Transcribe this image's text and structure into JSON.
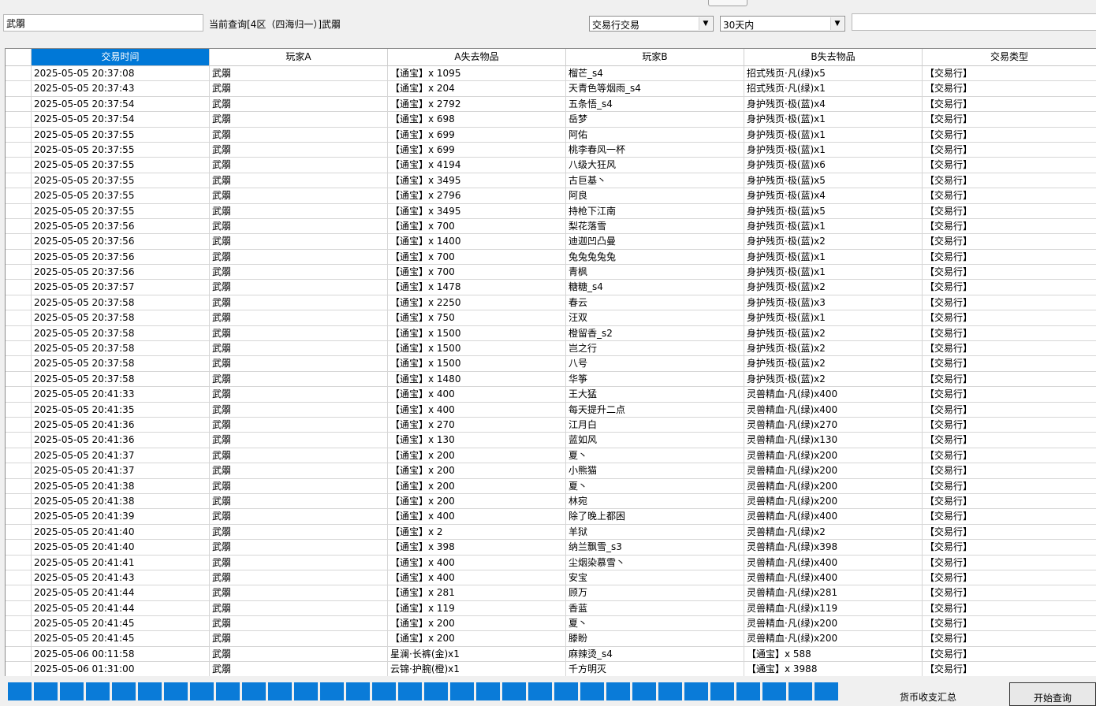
{
  "toolbar": {
    "search_value": "武朤",
    "query_label": "当前查询[4区（四海归一）]武朤",
    "trade_type_select": "交易行交易",
    "period_select": "30天内",
    "right_input_value": ""
  },
  "table": {
    "columns": [
      "交易时间",
      "玩家A",
      "A失去物品",
      "玩家B",
      "B失去物品",
      "交易类型"
    ],
    "rows": [
      [
        "2025-05-05 20:37:08",
        "武朤",
        "【通宝】x 1095",
        "榴芒_s4",
        "招式残页·凡(绿)x5",
        "【交易行】"
      ],
      [
        "2025-05-05 20:37:43",
        "武朤",
        "【通宝】x 204",
        "天青色等烟雨_s4",
        "招式残页·凡(绿)x1",
        "【交易行】"
      ],
      [
        "2025-05-05 20:37:54",
        "武朤",
        "【通宝】x 2792",
        "五条悟_s4",
        "身护残页·极(蓝)x4",
        "【交易行】"
      ],
      [
        "2025-05-05 20:37:54",
        "武朤",
        "【通宝】x 698",
        "岳梦",
        "身护残页·极(蓝)x1",
        "【交易行】"
      ],
      [
        "2025-05-05 20:37:55",
        "武朤",
        "【通宝】x 699",
        "阿佑",
        "身护残页·极(蓝)x1",
        "【交易行】"
      ],
      [
        "2025-05-05 20:37:55",
        "武朤",
        "【通宝】x 699",
        "桃李春风一杯",
        "身护残页·极(蓝)x1",
        "【交易行】"
      ],
      [
        "2025-05-05 20:37:55",
        "武朤",
        "【通宝】x 4194",
        "八级大狂风",
        "身护残页·极(蓝)x6",
        "【交易行】"
      ],
      [
        "2025-05-05 20:37:55",
        "武朤",
        "【通宝】x 3495",
        "古巨基丶",
        "身护残页·极(蓝)x5",
        "【交易行】"
      ],
      [
        "2025-05-05 20:37:55",
        "武朤",
        "【通宝】x 2796",
        "阿良",
        "身护残页·极(蓝)x4",
        "【交易行】"
      ],
      [
        "2025-05-05 20:37:55",
        "武朤",
        "【通宝】x 3495",
        "持枪下江南",
        "身护残页·极(蓝)x5",
        "【交易行】"
      ],
      [
        "2025-05-05 20:37:56",
        "武朤",
        "【通宝】x 700",
        "梨花落雪",
        "身护残页·极(蓝)x1",
        "【交易行】"
      ],
      [
        "2025-05-05 20:37:56",
        "武朤",
        "【通宝】x 1400",
        "迪迦凹凸曼",
        "身护残页·极(蓝)x2",
        "【交易行】"
      ],
      [
        "2025-05-05 20:37:56",
        "武朤",
        "【通宝】x 700",
        "兔兔兔兔兔",
        "身护残页·极(蓝)x1",
        "【交易行】"
      ],
      [
        "2025-05-05 20:37:56",
        "武朤",
        "【通宝】x 700",
        "青枫",
        "身护残页·极(蓝)x1",
        "【交易行】"
      ],
      [
        "2025-05-05 20:37:57",
        "武朤",
        "【通宝】x 1478",
        "糖糖_s4",
        "身护残页·极(蓝)x2",
        "【交易行】"
      ],
      [
        "2025-05-05 20:37:58",
        "武朤",
        "【通宝】x 2250",
        "春云",
        "身护残页·极(蓝)x3",
        "【交易行】"
      ],
      [
        "2025-05-05 20:37:58",
        "武朤",
        "【通宝】x 750",
        "汪双",
        "身护残页·极(蓝)x1",
        "【交易行】"
      ],
      [
        "2025-05-05 20:37:58",
        "武朤",
        "【通宝】x 1500",
        "橙留香_s2",
        "身护残页·极(蓝)x2",
        "【交易行】"
      ],
      [
        "2025-05-05 20:37:58",
        "武朤",
        "【通宝】x 1500",
        "岂之行",
        "身护残页·极(蓝)x2",
        "【交易行】"
      ],
      [
        "2025-05-05 20:37:58",
        "武朤",
        "【通宝】x 1500",
        "八号",
        "身护残页·极(蓝)x2",
        "【交易行】"
      ],
      [
        "2025-05-05 20:37:58",
        "武朤",
        "【通宝】x 1480",
        "华筝",
        "身护残页·极(蓝)x2",
        "【交易行】"
      ],
      [
        "2025-05-05 20:41:33",
        "武朤",
        "【通宝】x 400",
        "王大猛",
        "灵兽精血·凡(绿)x400",
        "【交易行】"
      ],
      [
        "2025-05-05 20:41:35",
        "武朤",
        "【通宝】x 400",
        "每天提升二点",
        "灵兽精血·凡(绿)x400",
        "【交易行】"
      ],
      [
        "2025-05-05 20:41:36",
        "武朤",
        "【通宝】x 270",
        "江月白",
        "灵兽精血·凡(绿)x270",
        "【交易行】"
      ],
      [
        "2025-05-05 20:41:36",
        "武朤",
        "【通宝】x 130",
        "蓝如风",
        "灵兽精血·凡(绿)x130",
        "【交易行】"
      ],
      [
        "2025-05-05 20:41:37",
        "武朤",
        "【通宝】x 200",
        "夏丶",
        "灵兽精血·凡(绿)x200",
        "【交易行】"
      ],
      [
        "2025-05-05 20:41:37",
        "武朤",
        "【通宝】x 200",
        "小熊猫",
        "灵兽精血·凡(绿)x200",
        "【交易行】"
      ],
      [
        "2025-05-05 20:41:38",
        "武朤",
        "【通宝】x 200",
        "夏丶",
        "灵兽精血·凡(绿)x200",
        "【交易行】"
      ],
      [
        "2025-05-05 20:41:38",
        "武朤",
        "【通宝】x 200",
        "林宛",
        "灵兽精血·凡(绿)x200",
        "【交易行】"
      ],
      [
        "2025-05-05 20:41:39",
        "武朤",
        "【通宝】x 400",
        "除了晚上都困",
        "灵兽精血·凡(绿)x400",
        "【交易行】"
      ],
      [
        "2025-05-05 20:41:40",
        "武朤",
        "【通宝】x 2",
        "羊狱",
        "灵兽精血·凡(绿)x2",
        "【交易行】"
      ],
      [
        "2025-05-05 20:41:40",
        "武朤",
        "【通宝】x 398",
        "纳兰飘雪_s3",
        "灵兽精血·凡(绿)x398",
        "【交易行】"
      ],
      [
        "2025-05-05 20:41:41",
        "武朤",
        "【通宝】x 400",
        "尘烟染慕雪丶",
        "灵兽精血·凡(绿)x400",
        "【交易行】"
      ],
      [
        "2025-05-05 20:41:43",
        "武朤",
        "【通宝】x 400",
        "安宝",
        "灵兽精血·凡(绿)x400",
        "【交易行】"
      ],
      [
        "2025-05-05 20:41:44",
        "武朤",
        "【通宝】x 281",
        "顾万",
        "灵兽精血·凡(绿)x281",
        "【交易行】"
      ],
      [
        "2025-05-05 20:41:44",
        "武朤",
        "【通宝】x 119",
        "香蓝",
        "灵兽精血·凡(绿)x119",
        "【交易行】"
      ],
      [
        "2025-05-05 20:41:45",
        "武朤",
        "【通宝】x 200",
        "夏丶",
        "灵兽精血·凡(绿)x200",
        "【交易行】"
      ],
      [
        "2025-05-05 20:41:45",
        "武朤",
        "【通宝】x 200",
        "滕盼",
        "灵兽精血·凡(绿)x200",
        "【交易行】"
      ],
      [
        "2025-05-06 00:11:58",
        "武朤",
        "星澜·长裤(金)x1",
        "麻辣烫_s4",
        "【通宝】x 588",
        "【交易行】"
      ],
      [
        "2025-05-06 01:31:00",
        "武朤",
        "云锦·护腕(橙)x1",
        "千方明灭",
        "【通宝】x 3988",
        "【交易行】"
      ]
    ]
  },
  "progress": {
    "segments_filled": 32,
    "color": "#0a7bd8"
  },
  "buttons": {
    "summary": "货币收支汇总",
    "start_query": "开始查询"
  }
}
